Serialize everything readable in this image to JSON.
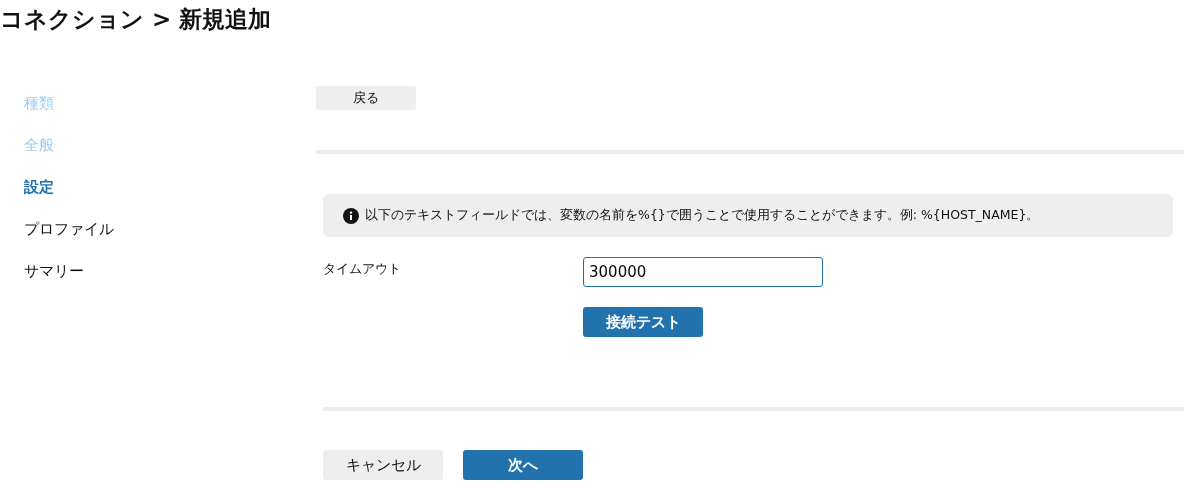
{
  "page_title": "コネクション > 新規追加",
  "steps": [
    {
      "label": "種類",
      "completed": true,
      "selected": false
    },
    {
      "label": "全般",
      "completed": true,
      "selected": false
    },
    {
      "label": "設定",
      "completed": false,
      "selected": true
    },
    {
      "label": "プロファイル",
      "completed": false,
      "selected": false
    },
    {
      "label": "サマリー",
      "completed": false,
      "selected": false
    }
  ],
  "back_button": "戻る",
  "info_message": "以下のテキストフィールドでは、変数の名前を%{}で囲うことで使用することができます。例: %{HOST_NAME}。",
  "fields": [
    {
      "label": "タイムアウト",
      "value": "300000"
    }
  ],
  "test_button": "接続テスト",
  "cancel_button": "キャンセル",
  "next_button": "次へ"
}
